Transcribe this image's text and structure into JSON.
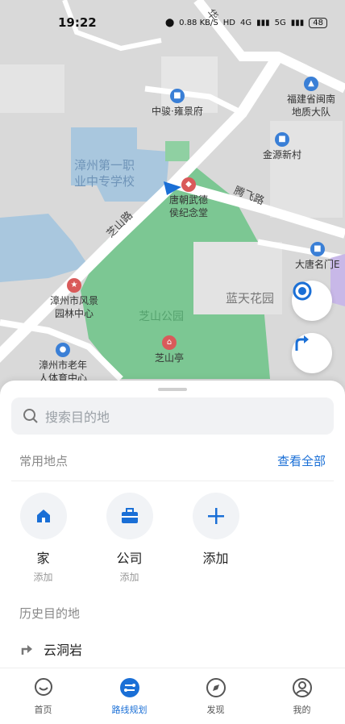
{
  "status_bar": {
    "time": "19:22",
    "speed": "0.88 KB/S",
    "hd": "HD",
    "net1": "4G",
    "net2": "5G",
    "battery": "48"
  },
  "map": {
    "pois": {
      "zhongjun": "中骏·雍景府",
      "fujian_line1": "福建省闽南",
      "fujian_line2": "地质大队",
      "jinyuan": "金源新村",
      "tangchao_line1": "唐朝武德",
      "tangchao_line2": "侯纪念堂",
      "datang": "大唐名门E",
      "fengjing_line1": "漳州市风景",
      "fengjing_line2": "园林中心",
      "laonian_line1": "漳州市老年",
      "laonian_line2": "人体育中心",
      "zhishanting": "芝山亭"
    },
    "areas": {
      "school_line1": "漳州第一职",
      "school_line2": "业中专学校",
      "lantian": "蓝天花园"
    },
    "roads": {
      "zhishan_road": "芝山路",
      "tengfei_road": "腾飞路",
      "top_road": "华"
    },
    "park": "芝山公园"
  },
  "sheet": {
    "search_placeholder": "搜索目的地",
    "common_title": "常用地点",
    "view_all": "查看全部",
    "places": [
      {
        "name": "家",
        "sub": "添加"
      },
      {
        "name": "公司",
        "sub": "添加"
      },
      {
        "name": "添加",
        "sub": ""
      }
    ],
    "history_title": "历史目的地",
    "history": [
      {
        "name": "云洞岩"
      }
    ]
  },
  "nav": [
    {
      "label": "首页"
    },
    {
      "label": "路线规划"
    },
    {
      "label": "发现"
    },
    {
      "label": "我的"
    }
  ],
  "colors": {
    "accent": "#1a6fd6",
    "park": "#6cc08b",
    "water": "#a9c7de"
  }
}
